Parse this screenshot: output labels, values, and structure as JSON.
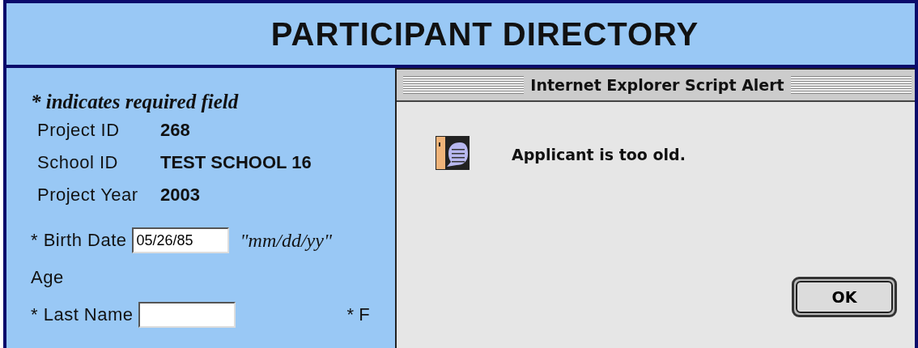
{
  "page": {
    "title": "PARTICIPANT DIRECTORY"
  },
  "form": {
    "note": "* indicates required field",
    "info": [
      {
        "label": "Project ID",
        "value": "268"
      },
      {
        "label": "School ID",
        "value": "TEST SCHOOL 16"
      },
      {
        "label": "Project Year",
        "value": "2003"
      }
    ],
    "birth_date": {
      "label": "* Birth Date",
      "value": "05/26/85",
      "hint": "\"mm/dd/yy\""
    },
    "age": {
      "label": "Age"
    },
    "last_name": {
      "label": "* Last Name"
    },
    "column_2_label": "* F"
  },
  "alert": {
    "title": "Internet Explorer Script Alert",
    "message": "Applicant is too old.",
    "button": "OK"
  }
}
